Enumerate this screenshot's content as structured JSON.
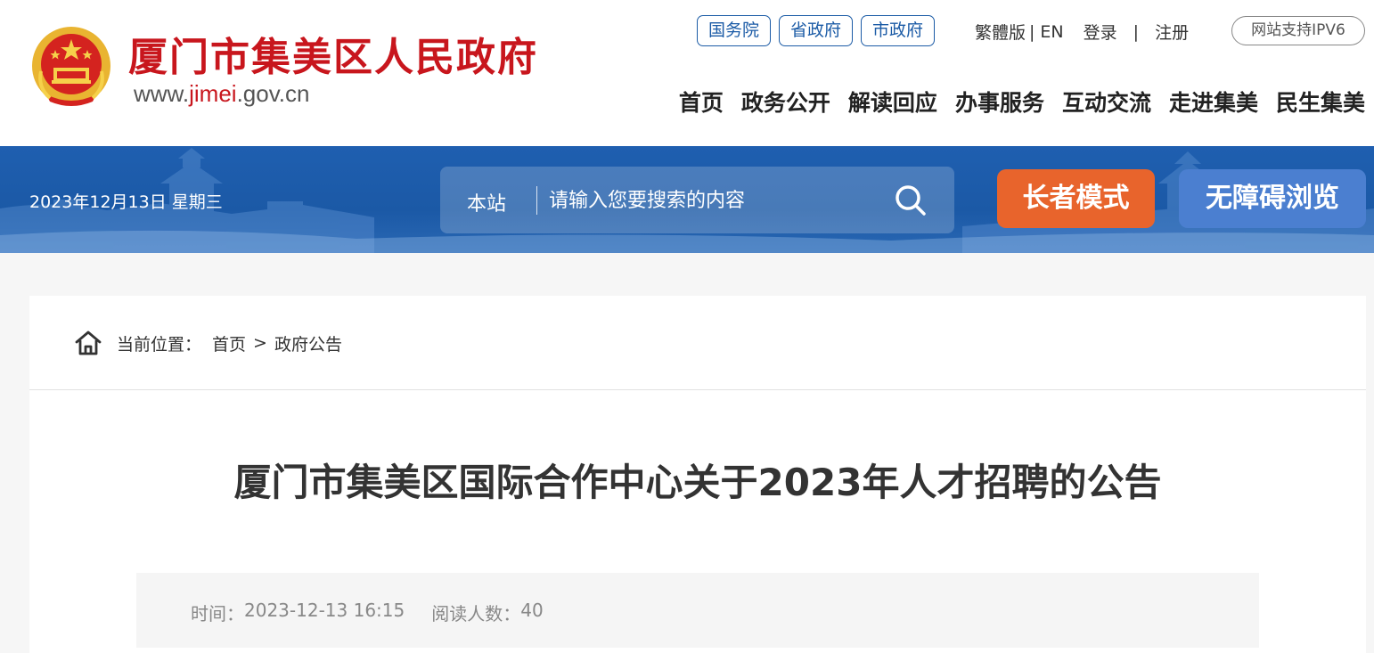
{
  "header": {
    "site_title": "厦门市集美区人民政府",
    "domain_prefix": "www.",
    "domain_highlight": "jimei",
    "domain_suffix": ".gov.cn",
    "gov_links": [
      "国务院",
      "省政府",
      "市政府"
    ],
    "traditional_label": "繁體版",
    "english_label": "EN",
    "login_label": "登录",
    "register_label": "注册",
    "ipv6_label": "网站支持IPV6",
    "nav": [
      "首页",
      "政务公开",
      "解读回应",
      "办事服务",
      "互动交流",
      "走进集美",
      "民生集美"
    ]
  },
  "banner": {
    "date": "2023年12月13日 星期三",
    "search_scope": "本站",
    "search_placeholder": "请输入您要搜索的内容",
    "elder_mode_label": "长者模式",
    "accessible_label": "无障碍浏览"
  },
  "breadcrumb": {
    "prefix": "当前位置：",
    "home": "首页",
    "separator": ">",
    "current": "政府公告"
  },
  "article": {
    "title": "厦门市集美区国际合作中心关于2023年人才招聘的公告",
    "time_label": "时间：",
    "time_value": "2023-12-13 16:15",
    "reads_label": "阅读人数：",
    "reads_value": "40"
  },
  "colors": {
    "brand_red": "#c8161d",
    "brand_blue": "#1b59a6",
    "elder_orange": "#e8642c",
    "access_blue": "#4b7fd0"
  }
}
